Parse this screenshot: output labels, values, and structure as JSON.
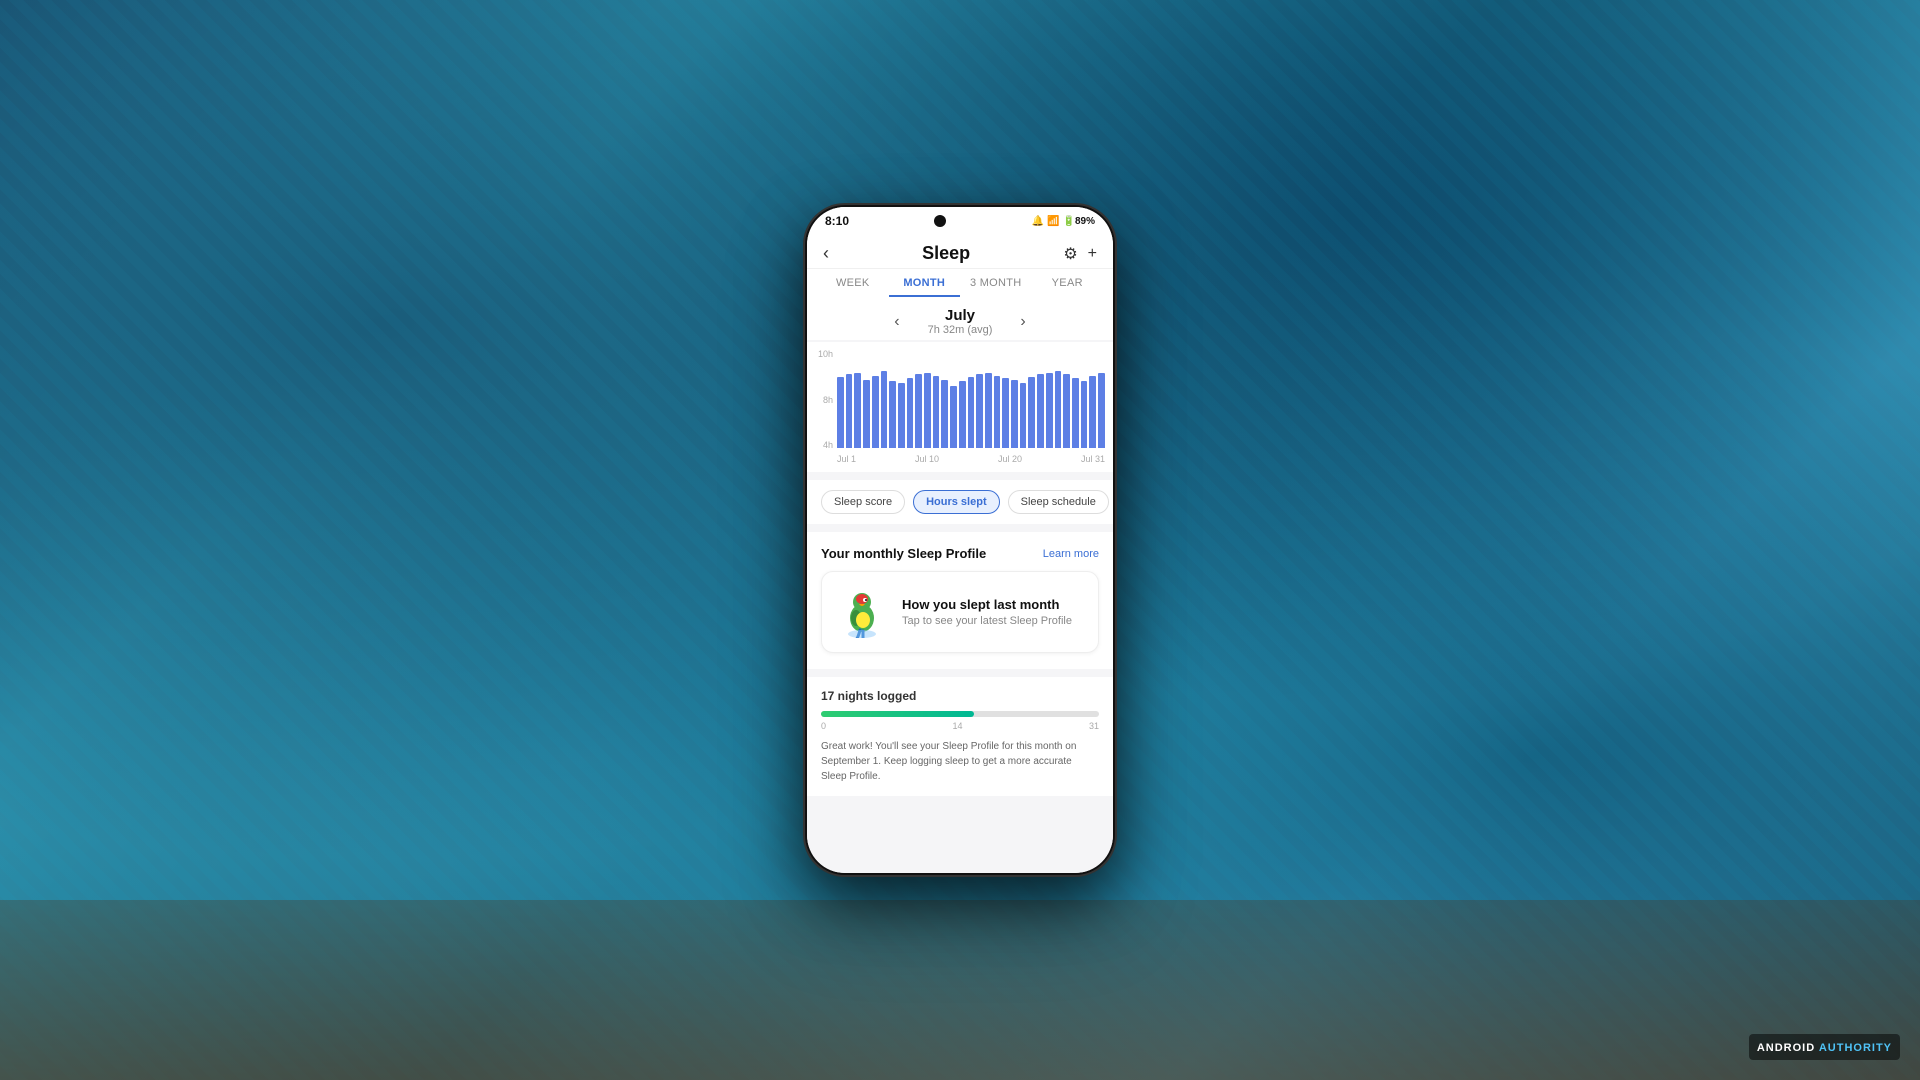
{
  "background": {
    "colors": [
      "#1a5272",
      "#2d8faa",
      "#1a6680",
      "#3a9bbf"
    ]
  },
  "status_bar": {
    "time": "8:10",
    "icons": "🔔 📶 🔋 89%"
  },
  "header": {
    "back_label": "‹",
    "title": "Sleep",
    "settings_icon": "⚙",
    "add_icon": "+"
  },
  "tabs": [
    {
      "label": "WEEK",
      "active": false
    },
    {
      "label": "MONTH",
      "active": true
    },
    {
      "label": "3 MONTH",
      "active": false
    },
    {
      "label": "YEAR",
      "active": false
    }
  ],
  "month_nav": {
    "prev_arrow": "‹",
    "next_arrow": "›",
    "month_name": "July",
    "avg_label": "7h 32m (avg)"
  },
  "chart": {
    "y_labels": [
      "10h",
      "8h",
      "4h"
    ],
    "x_labels": [
      "Jul 1",
      "Jul 10",
      "Jul 20",
      "Jul 31"
    ],
    "bars": [
      75,
      78,
      80,
      72,
      76,
      82,
      70,
      68,
      74,
      78,
      80,
      76,
      72,
      65,
      70,
      75,
      78,
      80,
      76,
      74,
      72,
      68,
      75,
      78,
      80,
      82,
      78,
      74,
      70,
      76,
      80
    ],
    "color": "#4169e1"
  },
  "filter_pills": [
    {
      "label": "Sleep score",
      "active": false
    },
    {
      "label": "Hours slept",
      "active": true
    },
    {
      "label": "Sleep schedule",
      "active": false
    }
  ],
  "sleep_profile": {
    "section_title": "Your monthly Sleep Profile",
    "learn_more": "Learn more",
    "card": {
      "title": "How you slept last month",
      "subtitle": "Tap to see your latest Sleep Profile"
    }
  },
  "nights_logged": {
    "label": "17 nights logged",
    "progress_percent": 55,
    "tick_start": "0",
    "tick_mid": "14",
    "tick_end": "31",
    "description": "Great work! You'll see your Sleep Profile for this month on September 1. Keep logging sleep to get a more accurate Sleep Profile."
  },
  "watermark": {
    "prefix": "ANDROID",
    "suffix": " AUTHORITY"
  }
}
